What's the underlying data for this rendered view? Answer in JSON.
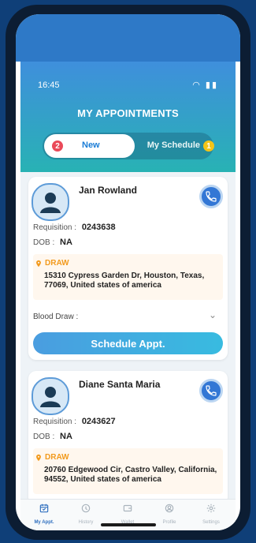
{
  "status_bar": {
    "time": "16:45",
    "icons": "wifi battery"
  },
  "header": {
    "title": "MY APPOINTMENTS",
    "toggle": {
      "new_label": "New",
      "new_count": "2",
      "schedule_label": "My Schedule",
      "schedule_count": "1"
    }
  },
  "appointments": [
    {
      "name": "Jan Rowland",
      "requisition_label": "Requisition :",
      "requisition": "0243638",
      "dob_label": "DOB :",
      "dob": "NA",
      "draw_label": "DRAW",
      "address": "15310 Cypress Garden Dr, Houston, Texas, 77069, United states of america",
      "blood_draw_label": "Blood Draw :",
      "button": "Schedule Appt."
    },
    {
      "name": "Diane Santa Maria",
      "requisition_label": "Requisition :",
      "requisition": "0243627",
      "dob_label": "DOB :",
      "dob": "NA",
      "draw_label": "DRAW",
      "address": "20760 Edgewood Cir, Castro Valley, California, 94552, United states of america"
    }
  ],
  "tabbar": {
    "items": [
      {
        "label": "My Appt.",
        "icon": "calendar-icon"
      },
      {
        "label": "History",
        "icon": "clock-icon"
      },
      {
        "label": "Wallet",
        "icon": "wallet-icon"
      },
      {
        "label": "Profile",
        "icon": "profile-icon"
      },
      {
        "label": "Settings",
        "icon": "gear-icon"
      }
    ]
  },
  "colors": {
    "header_top": "#3f8fdc",
    "header_bottom": "#28b2b4",
    "accent_blue": "#3377d5",
    "draw_orange": "#f29a1d",
    "badge_red": "#ea4a59",
    "badge_yellow": "#f3c417"
  }
}
